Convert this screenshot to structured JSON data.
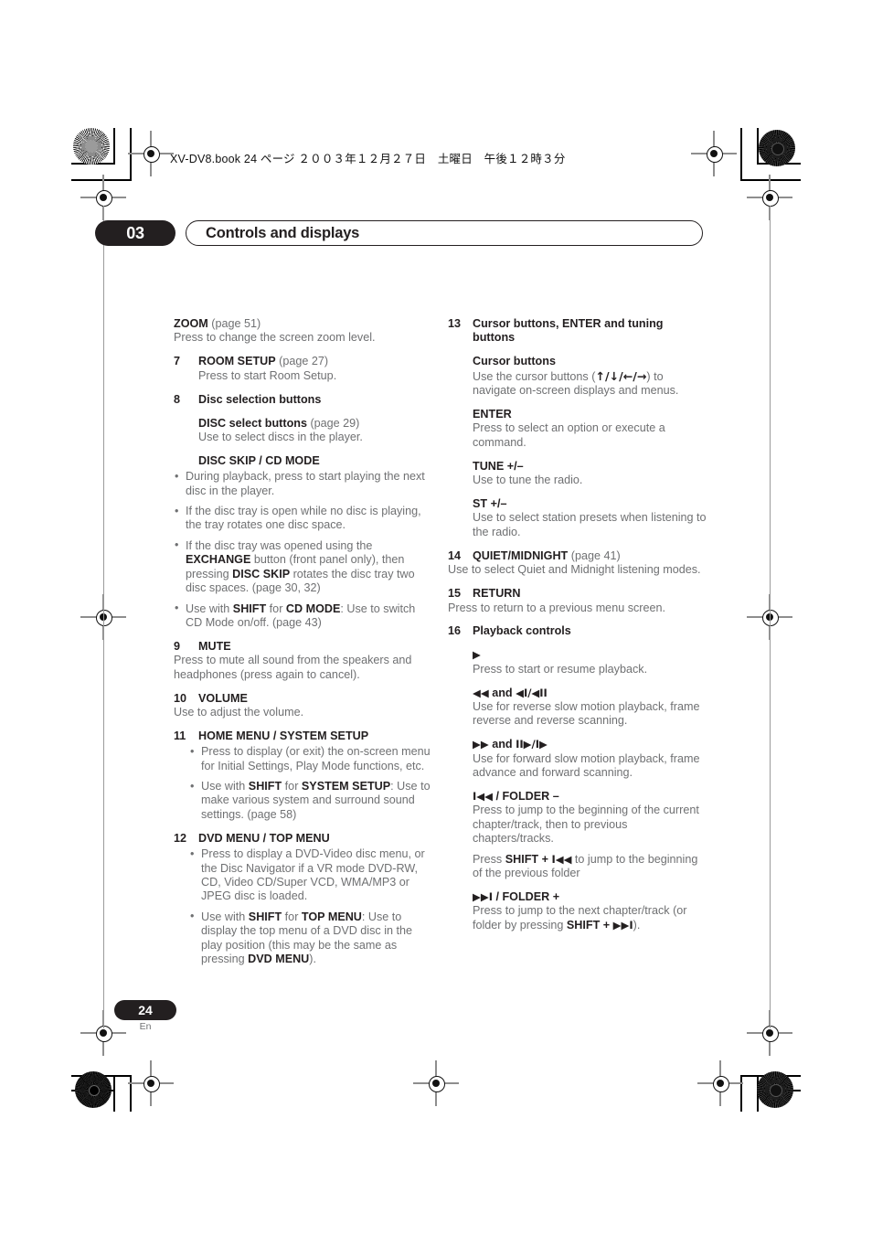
{
  "print_header": {
    "file_line": "XV-DV8.book  24 ページ  ２００３年１２月２７日　土曜日　午後１２時３分"
  },
  "chapter": {
    "number": "03",
    "title": "Controls and displays"
  },
  "footer": {
    "page_number": "24",
    "language": "En"
  },
  "left_column": {
    "zoom": {
      "heading": "ZOOM",
      "page_ref": "(page 51)",
      "body": "Press to change the screen zoom level."
    },
    "item7": {
      "number": "7",
      "heading": "ROOM SETUP",
      "page_ref": "(page 27)",
      "body": "Press to start Room Setup."
    },
    "item8": {
      "number": "8",
      "heading": "Disc selection buttons",
      "disc_select": {
        "heading": "DISC select buttons",
        "page_ref": "(page 29)",
        "body": "Use to select discs in the player."
      },
      "disc_skip": {
        "heading": "DISC SKIP / CD MODE",
        "bullets": [
          "During playback, press to start playing the next disc in the player.",
          "If the disc tray is open while no disc is playing, the tray rotates one disc space."
        ],
        "bullet3_a": "If the disc tray was opened using the ",
        "bullet3_b": "EXCHANGE",
        "bullet3_c": " button (front panel only), then pressing ",
        "bullet3_d": "DISC SKIP",
        "bullet3_e": " rotates the disc tray two disc spaces. (page 30, 32)",
        "bullet4_a": "Use with ",
        "bullet4_b": "SHIFT",
        "bullet4_c": " for ",
        "bullet4_d": "CD MODE",
        "bullet4_e": ": Use to switch CD Mode on/off. (page 43)"
      }
    },
    "item9": {
      "number": "9",
      "heading": "MUTE",
      "body": "Press to mute all sound from the speakers and headphones (press again to cancel)."
    },
    "item10": {
      "number": "10",
      "heading": "VOLUME",
      "body": "Use to adjust the volume."
    },
    "item11": {
      "number": "11",
      "heading": "HOME MENU / SYSTEM SETUP",
      "bullet1": "Press to display (or exit) the on-screen menu for Initial Settings, Play Mode functions, etc.",
      "bullet2_a": "Use with ",
      "bullet2_b": "SHIFT",
      "bullet2_c": " for ",
      "bullet2_d": "SYSTEM SETUP",
      "bullet2_e": ": Use to make various system and surround sound settings. (page 58)"
    },
    "item12": {
      "number": "12",
      "heading": "DVD MENU / TOP MENU",
      "bullet1": "Press to display a DVD-Video disc menu, or the Disc Navigator if a VR mode DVD-RW, CD, Video CD/Super VCD, WMA/MP3 or JPEG disc is loaded.",
      "bullet2_a": "Use with ",
      "bullet2_b": "SHIFT",
      "bullet2_c": " for ",
      "bullet2_d": "TOP MENU",
      "bullet2_e": ": Use to display the top menu of a DVD disc in the play position (this may be the same as pressing ",
      "bullet2_f": "DVD MENU",
      "bullet2_g": ")."
    }
  },
  "right_column": {
    "item13": {
      "number": "13",
      "heading": "Cursor buttons, ENTER and tuning buttons",
      "cursor": {
        "heading": "Cursor buttons",
        "body_a": "Use the cursor buttons (",
        "glyphs": "↑/↓/←/→",
        "body_b": ") to navigate on-screen displays and menus."
      },
      "enter": {
        "heading": "ENTER",
        "body": "Press to select an option or execute a command."
      },
      "tune": {
        "heading": "TUNE +/–",
        "body": "Use to tune the radio."
      },
      "st": {
        "heading": "ST +/–",
        "body": "Use to select station presets when listening to the radio."
      }
    },
    "item14": {
      "number": "14",
      "heading": "QUIET/MIDNIGHT",
      "page_ref": "(page 41)",
      "body": "Use to select Quiet and Midnight listening modes."
    },
    "item15": {
      "number": "15",
      "heading": "RETURN",
      "body": "Press to return to a previous menu screen."
    },
    "item16": {
      "number": "16",
      "heading": "Playback controls",
      "play": {
        "glyph": "▶",
        "body": "Press to start or resume playback."
      },
      "reverse": {
        "glyph": "◀◀",
        "and": " and ",
        "glyph2": "◀I/◀II",
        "body": "Use for reverse slow motion playback, frame reverse and reverse scanning."
      },
      "forward": {
        "glyph": "▶▶",
        "and": " and ",
        "glyph2": "II▶/I▶",
        "body": "Use for forward slow motion playback, frame advance and forward scanning."
      },
      "folder_minus": {
        "glyph": "I◀◀",
        "heading_rest": " / FOLDER –",
        "body": "Press to jump to the beginning of the current chapter/track, then to previous chapters/tracks.",
        "body2_a": "Press ",
        "body2_b": "SHIFT",
        "body2_c": " + ",
        "body2_glyph": "I◀◀",
        "body2_d": " to jump to the beginning of the previous folder"
      },
      "folder_plus": {
        "glyph": "▶▶I",
        "heading_rest": " / FOLDER +",
        "body_a": "Press to jump to the next chapter/track (or folder by pressing ",
        "body_b": "SHIFT",
        "body_c": " + ",
        "body_glyph": "▶▶I",
        "body_d": ")."
      }
    }
  }
}
